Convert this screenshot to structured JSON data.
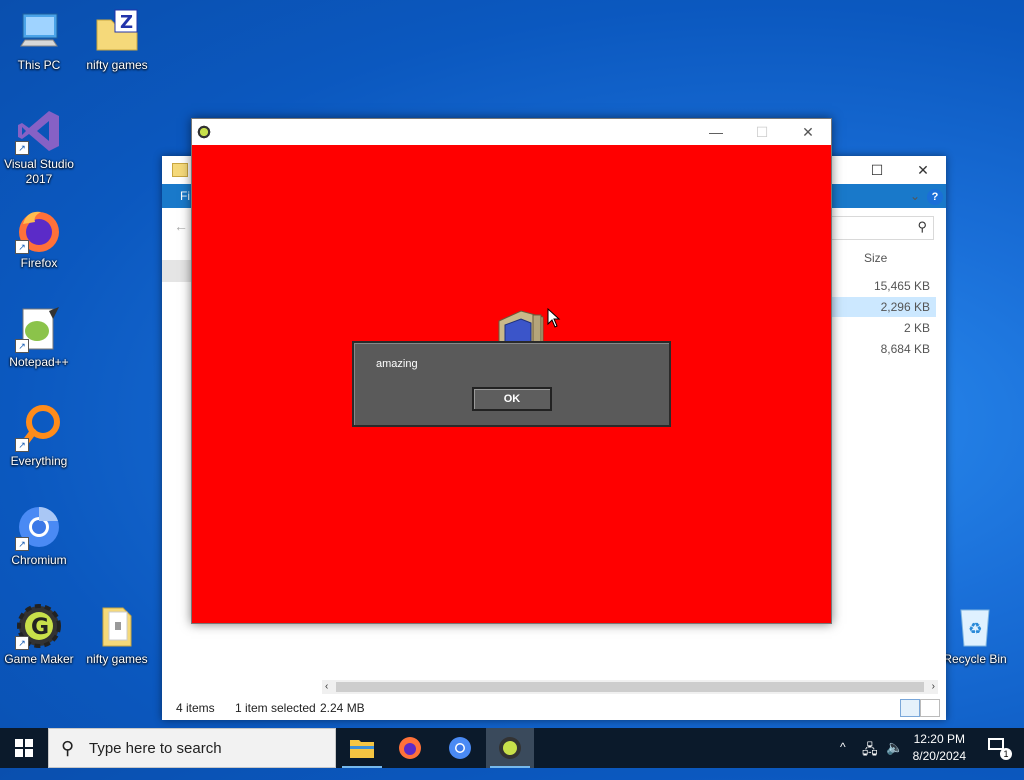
{
  "desktop": {
    "icons": [
      {
        "label": "This PC"
      },
      {
        "label": "nifty games"
      },
      {
        "label": "Visual Studio 2017"
      },
      {
        "label": "Firefox"
      },
      {
        "label": "Notepad++"
      },
      {
        "label": "Everything"
      },
      {
        "label": "Chromium"
      },
      {
        "label": "Game Maker"
      },
      {
        "label": "nifty games"
      },
      {
        "label": "Recycle Bin"
      }
    ]
  },
  "explorer": {
    "ribbon_file": "Fi",
    "column_size": "Size",
    "rows": [
      {
        "size": "15,465 KB",
        "selected": false
      },
      {
        "size": "2,296 KB",
        "selected": true
      },
      {
        "size": "2 KB",
        "selected": false
      },
      {
        "size": "8,684 KB",
        "selected": false
      }
    ],
    "status": {
      "items": "4 items",
      "selected": "1 item selected",
      "size": "2.24 MB"
    }
  },
  "dialog": {
    "message": "amazing",
    "ok_label": "OK"
  },
  "taskbar": {
    "search_placeholder": "Type here to search",
    "clock": {
      "time": "12:20 PM",
      "date": "8/20/2024"
    },
    "notification_count": "1"
  },
  "colors": {
    "game_bg": "#ff0000",
    "dialog_bg": "#5a5a5a",
    "taskbar_bg": "#0b1a2b",
    "selection": "#cce8ff"
  }
}
